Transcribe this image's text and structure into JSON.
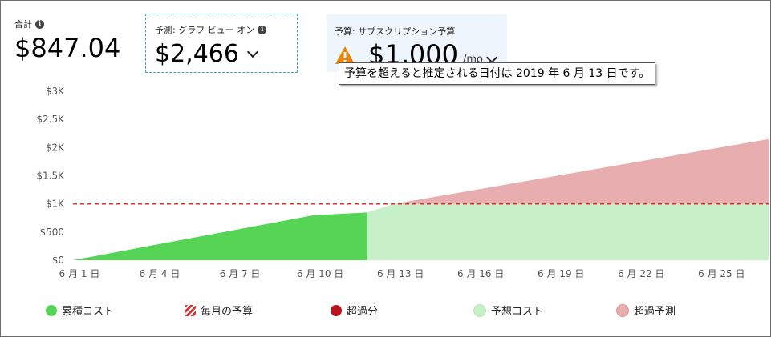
{
  "summary": {
    "total": {
      "label": "合計",
      "value": "$847.04"
    },
    "forecast": {
      "label": "予測: グラフ ビュー オン",
      "value": "$2,466"
    },
    "budget": {
      "label": "予算: サブスクリプション予算",
      "value": "$1,000",
      "unit": "/mo"
    }
  },
  "tooltip": "予算を超えると推定される日付は 2019 年 6 月 13 日です。",
  "colors": {
    "accumulated": "#56d456",
    "forecast": "#c8f0c8",
    "overage": "#b8131f",
    "overage_forecast": "#e8adae",
    "budget_line": "#d33333"
  },
  "legend": [
    {
      "label": "累積コスト",
      "color": "#56d456",
      "pattern": "solid"
    },
    {
      "label": "毎月の予算",
      "color": "#d33333",
      "pattern": "striped"
    },
    {
      "label": "超過分",
      "color": "#b8131f",
      "pattern": "solid"
    },
    {
      "label": "予想コスト",
      "color": "#c8f0c8",
      "pattern": "solid"
    },
    {
      "label": "超過予測",
      "color": "#e8adae",
      "pattern": "solid"
    }
  ],
  "chart_data": {
    "type": "area",
    "x_ticks": [
      "6 月 1 日",
      "6 月 4 日",
      "6 月 7 日",
      "6 月 10 日",
      "6 月 13 日",
      "6 月 16 日",
      "6 月 19 日",
      "6 月 22 日",
      "6 月 25 日"
    ],
    "x_tick_days": [
      1,
      4,
      7,
      10,
      13,
      16,
      19,
      22,
      25
    ],
    "y_ticks": [
      "$0",
      "$500",
      "$1K",
      "$1.5K",
      "$2K",
      "$2.5K",
      "$3K"
    ],
    "y_tick_values": [
      0,
      500,
      1000,
      1500,
      2000,
      2500,
      3000
    ],
    "xlim": [
      1,
      27
    ],
    "ylim": [
      0,
      3000
    ],
    "budget": 1000,
    "series": [
      {
        "name": "累積コスト",
        "x": [
          1,
          10,
          12
        ],
        "y": [
          0,
          800,
          847
        ]
      },
      {
        "name": "予想コスト",
        "x": [
          12,
          13,
          27
        ],
        "y": [
          847,
          1000,
          2150
        ]
      }
    ],
    "grid": false,
    "legend_position": "bottom"
  }
}
